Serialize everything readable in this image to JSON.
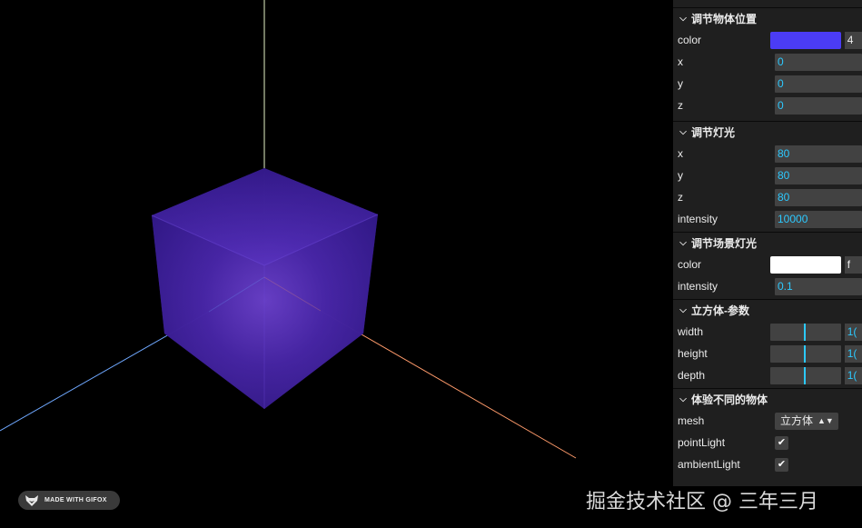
{
  "gui": {
    "folders": [
      {
        "title": "调节物体位置",
        "rows": [
          {
            "label": "color",
            "value": "4",
            "color": "#4b3cf5"
          },
          {
            "label": "x",
            "value": "0"
          },
          {
            "label": "y",
            "value": "0"
          },
          {
            "label": "z",
            "value": "0"
          }
        ]
      },
      {
        "title": "调节灯光",
        "rows": [
          {
            "label": "x",
            "value": "80"
          },
          {
            "label": "y",
            "value": "80"
          },
          {
            "label": "z",
            "value": "80"
          },
          {
            "label": "intensity",
            "value": "10000"
          }
        ]
      },
      {
        "title": "调节场景灯光",
        "rows": [
          {
            "label": "color",
            "value": "f",
            "color": "#ffffff"
          },
          {
            "label": "intensity",
            "value": "0.1"
          }
        ]
      },
      {
        "title": "立方体-参数",
        "rows": [
          {
            "label": "width",
            "value": "1(",
            "slider_fraction": 0.47
          },
          {
            "label": "height",
            "value": "1(",
            "slider_fraction": 0.47
          },
          {
            "label": "depth",
            "value": "1(",
            "slider_fraction": 0.47
          }
        ]
      },
      {
        "title": "体验不同的物体",
        "rows": [
          {
            "label": "mesh",
            "value": "立方体"
          },
          {
            "label": "pointLight",
            "value": "✔"
          },
          {
            "label": "ambientLight",
            "value": "✔"
          }
        ]
      }
    ]
  },
  "badge": {
    "text": "MADE WITH GIFOX"
  },
  "watermark": {
    "text": "掘金技术社区 @ 三年三月"
  },
  "colors": {
    "cube_face": "#3b1f8f",
    "axis_y": "#e6f5c6",
    "axis_x": "#ff9b6b",
    "axis_z": "#6fa8ff",
    "accent": "#2cc9ff"
  }
}
